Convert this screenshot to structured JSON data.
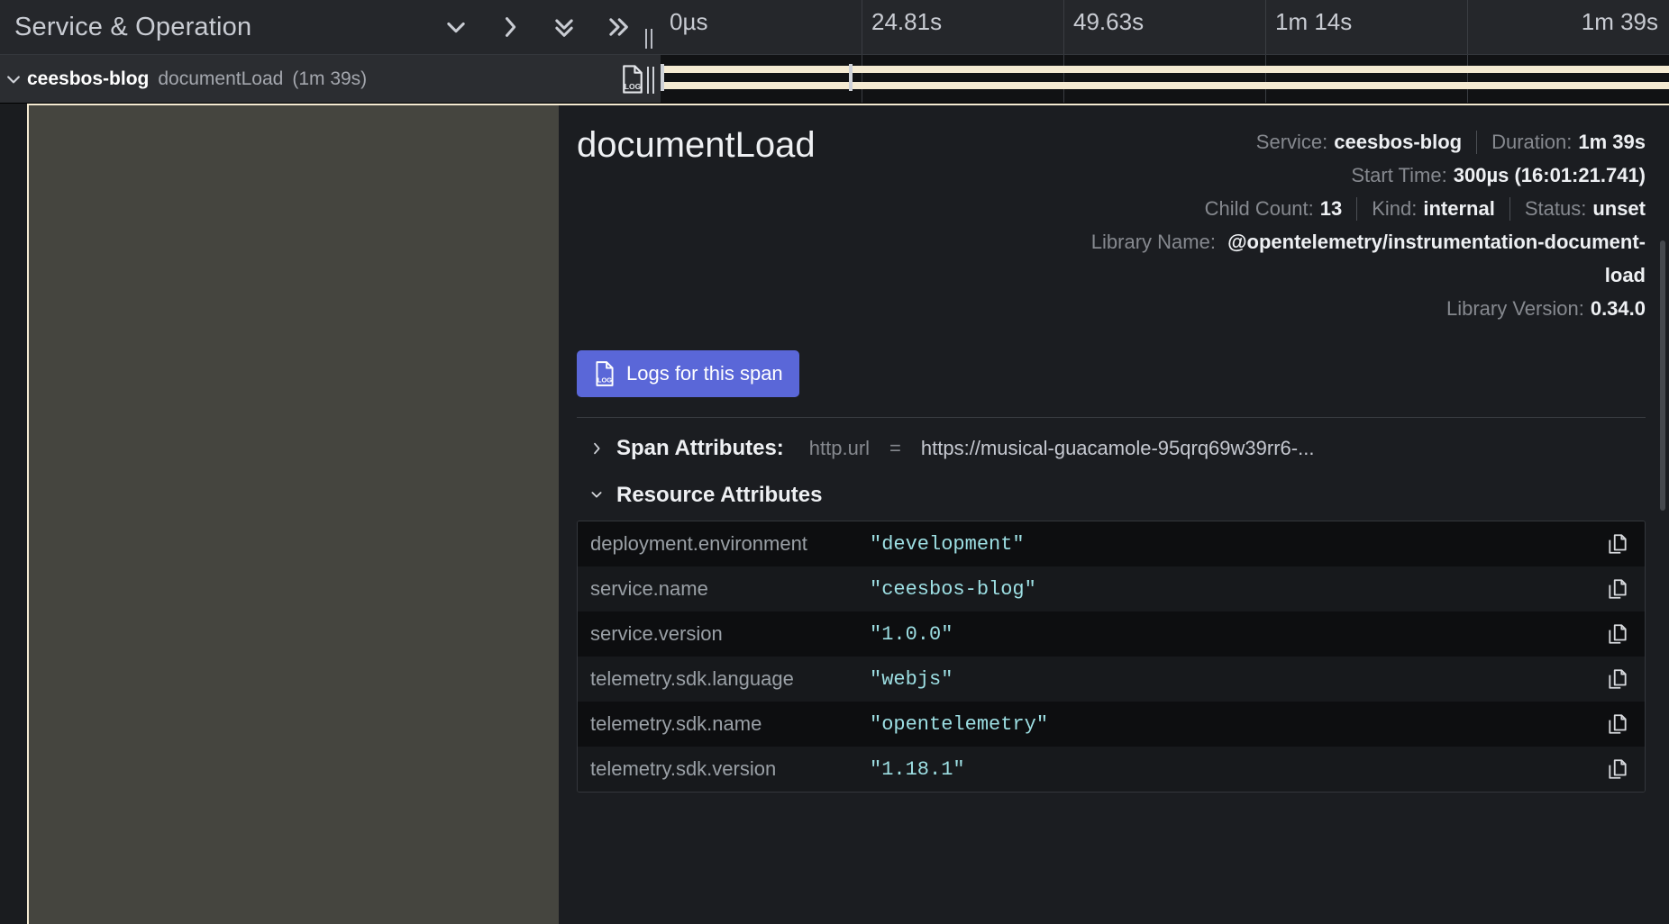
{
  "header": {
    "column_title": "Service & Operation",
    "icons": [
      {
        "name": "chevron-down-icon",
        "glyph": "collapse-one"
      },
      {
        "name": "chevron-right-icon",
        "glyph": "expand-one"
      },
      {
        "name": "chevrons-down-icon",
        "glyph": "collapse-all"
      },
      {
        "name": "chevrons-right-icon",
        "glyph": "expand-all"
      }
    ],
    "ticks": [
      {
        "label": "0µs"
      },
      {
        "label": "24.81s"
      },
      {
        "label": "49.63s"
      },
      {
        "label": "1m 14s"
      },
      {
        "label": "1m 39s"
      }
    ]
  },
  "span_row": {
    "caret": "expanded",
    "service": "ceesbos-blog",
    "operation": "documentLoad",
    "duration": "(1m 39s)",
    "log_icon": "LOG",
    "bar_color": "#f4ead2"
  },
  "detail": {
    "operation_name": "documentLoad",
    "meta": {
      "service_label": "Service:",
      "service_value": "ceesbos-blog",
      "duration_label": "Duration:",
      "duration_value": "1m 39s",
      "start_time_label": "Start Time:",
      "start_time_value": "300µs (16:01:21.741)",
      "child_count_label": "Child Count:",
      "child_count_value": "13",
      "kind_label": "Kind:",
      "kind_value": "internal",
      "status_label": "Status:",
      "status_value": "unset",
      "library_name_label": "Library Name:",
      "library_name_value": "@opentelemetry/instrumentation-document-load",
      "library_version_label": "Library Version:",
      "library_version_value": "0.34.0"
    },
    "logs_button": {
      "label": "Logs for this span",
      "icon": "log-file-icon",
      "color": "#5a67d8"
    },
    "span_attributes": {
      "label": "Span Attributes:",
      "collapsed": true,
      "preview_key": "http.url",
      "preview_eq": "=",
      "preview_value": "https://musical-guacamole-95qrq69w39rr6-..."
    },
    "resource_attributes": {
      "label": "Resource Attributes",
      "collapsed": false,
      "rows": [
        {
          "key": "deployment.environment",
          "value": "\"development\"",
          "copy": "copy-icon"
        },
        {
          "key": "service.name",
          "value": "\"ceesbos-blog\"",
          "copy": "copy-icon"
        },
        {
          "key": "service.version",
          "value": "\"1.0.0\"",
          "copy": "copy-icon"
        },
        {
          "key": "telemetry.sdk.language",
          "value": "\"webjs\"",
          "copy": "copy-icon"
        },
        {
          "key": "telemetry.sdk.name",
          "value": "\"opentelemetry\"",
          "copy": "copy-icon"
        },
        {
          "key": "telemetry.sdk.version",
          "value": "\"1.18.1\"",
          "copy": "copy-icon"
        }
      ]
    }
  }
}
